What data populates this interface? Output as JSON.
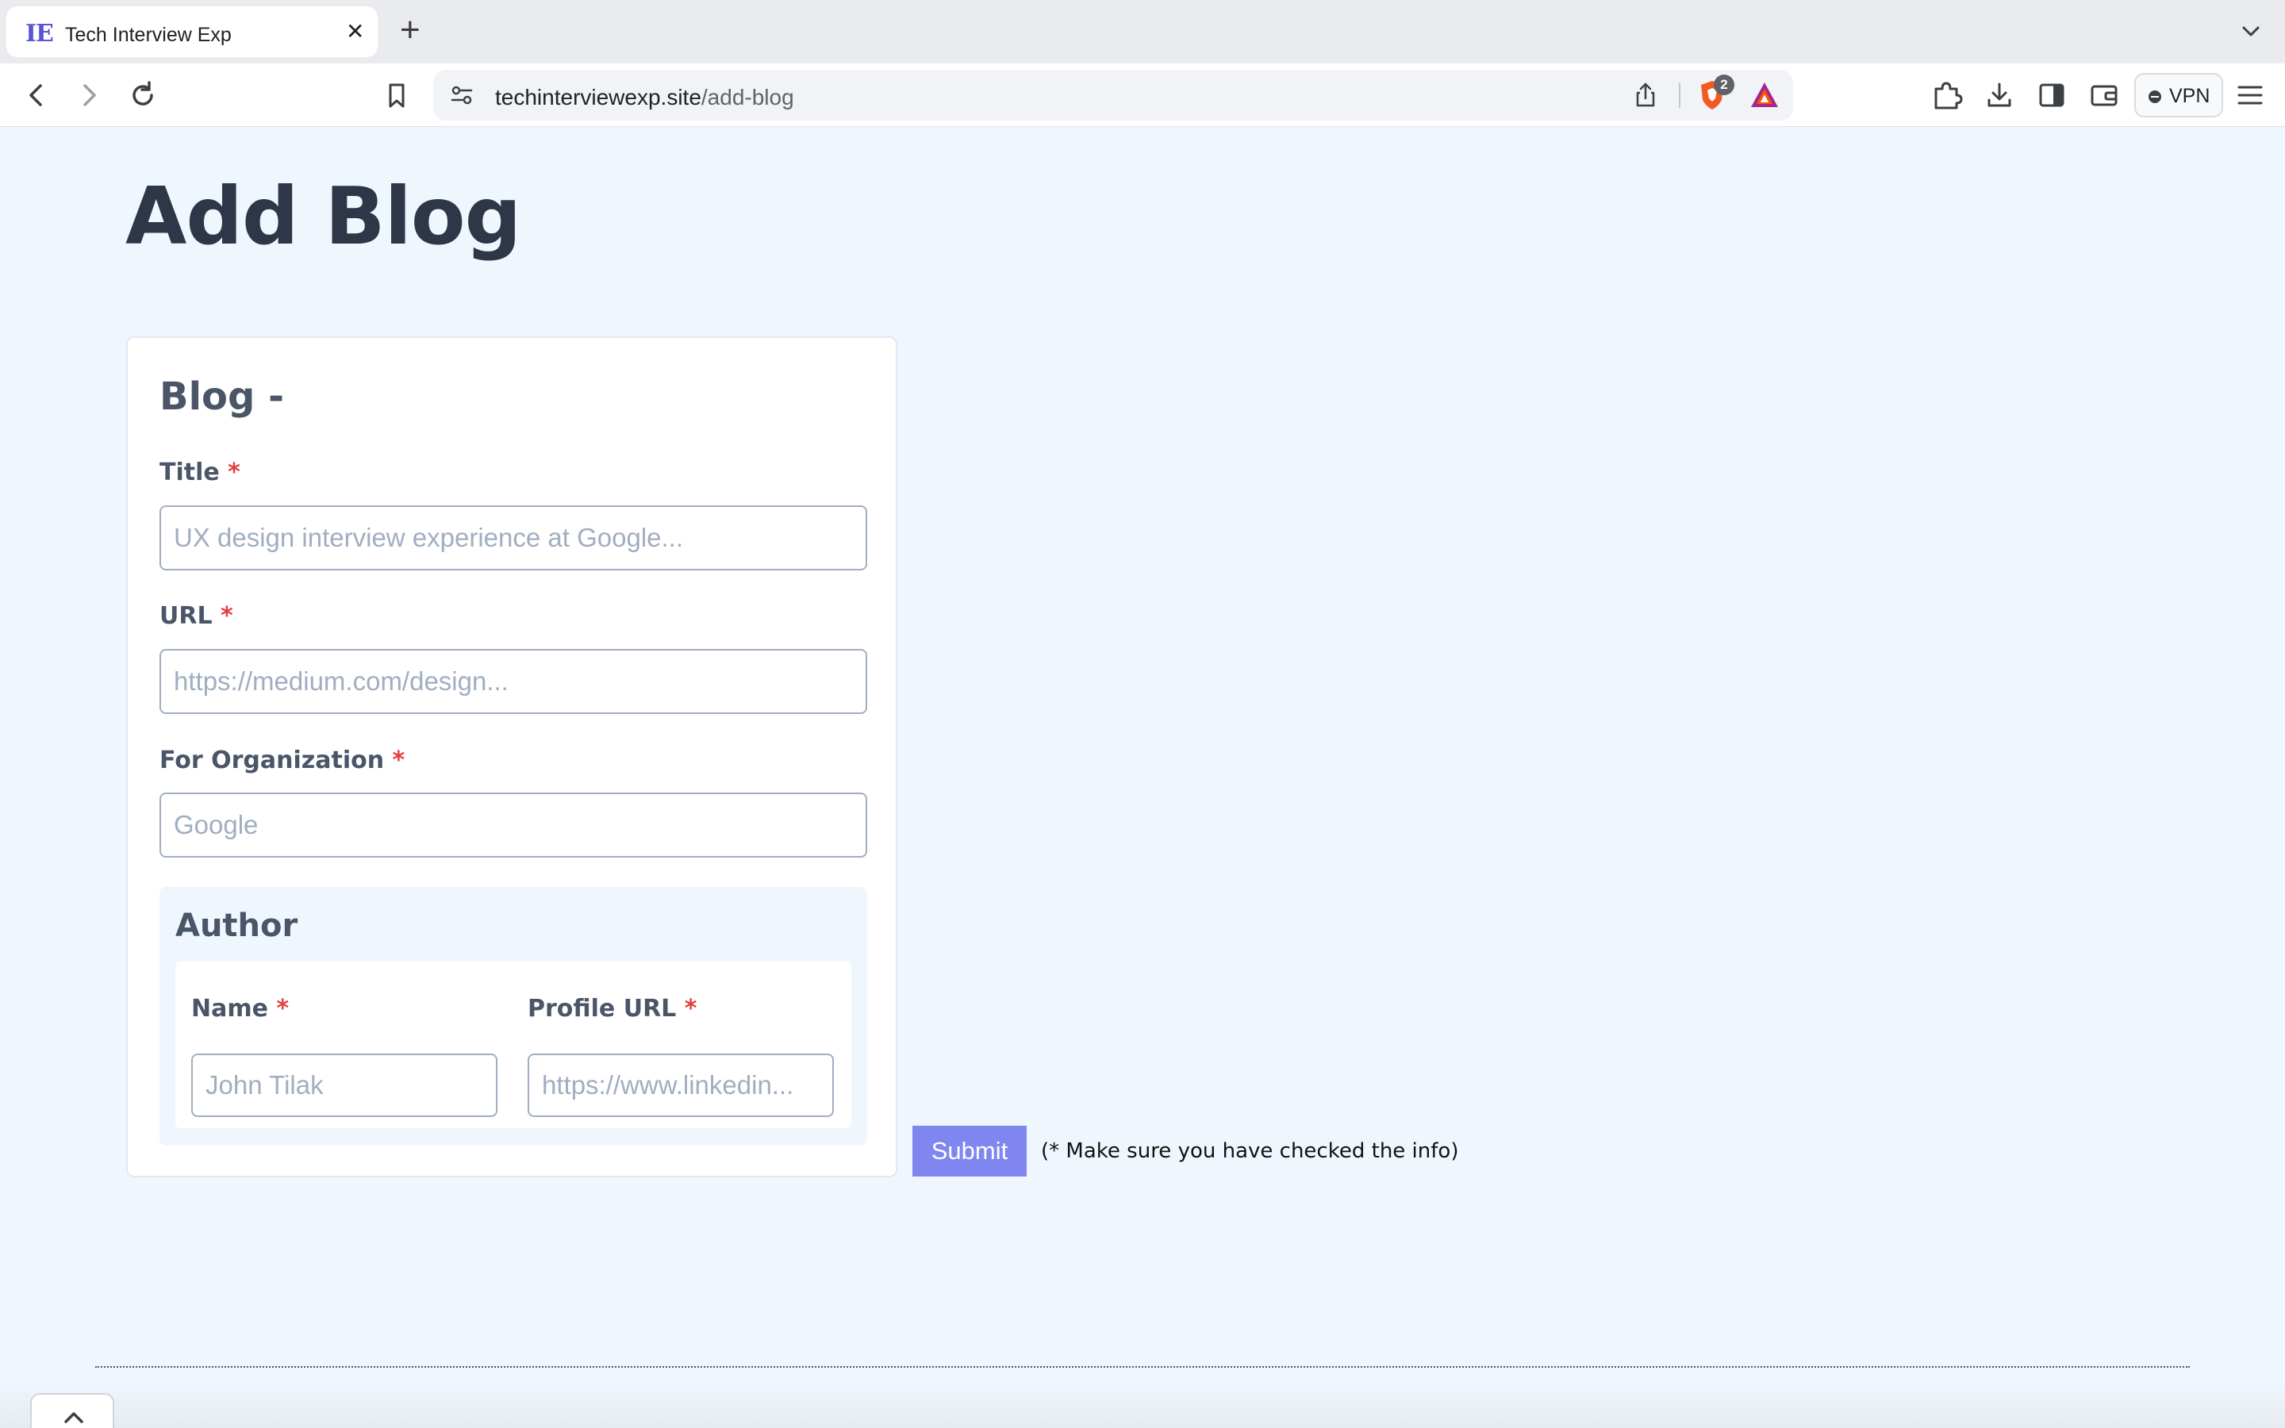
{
  "browser": {
    "tab": {
      "favicon_text": "IE",
      "title": "Tech Interview Exp"
    },
    "address": {
      "domain": "techinterviewexp.site",
      "path": "/add-blog"
    },
    "shield_count": "2",
    "vpn_label": "VPN"
  },
  "page": {
    "title": "Add Blog"
  },
  "form": {
    "heading": "Blog -",
    "required_mark": "*",
    "title_field": {
      "label": "Title",
      "placeholder": "UX design interview experience at Google..."
    },
    "url_field": {
      "label": "URL",
      "placeholder": "https://medium.com/design..."
    },
    "org_field": {
      "label": "For Organization",
      "placeholder": "Google"
    },
    "author": {
      "heading": "Author",
      "name_field": {
        "label": "Name",
        "placeholder": "John Tilak"
      },
      "profile_field": {
        "label": "Profile URL",
        "placeholder": "https://www.linkedin..."
      }
    },
    "submit_label": "Submit",
    "submit_note": "(* Make sure you have checked the info)"
  },
  "colors": {
    "page_background": "#f0f6fd",
    "heading_text": "#2d3748",
    "required": "#e53e3e",
    "submit_button": "#7f86f0"
  },
  "icons": [
    "back-icon",
    "forward-icon",
    "reload-icon",
    "bookmark-icon",
    "site-settings-icon",
    "share-icon",
    "brave-shield-icon",
    "brave-rewards-icon",
    "extensions-icon",
    "downloads-icon",
    "sidebar-icon",
    "wallet-icon",
    "menu-icon",
    "chevron-up-icon"
  ]
}
